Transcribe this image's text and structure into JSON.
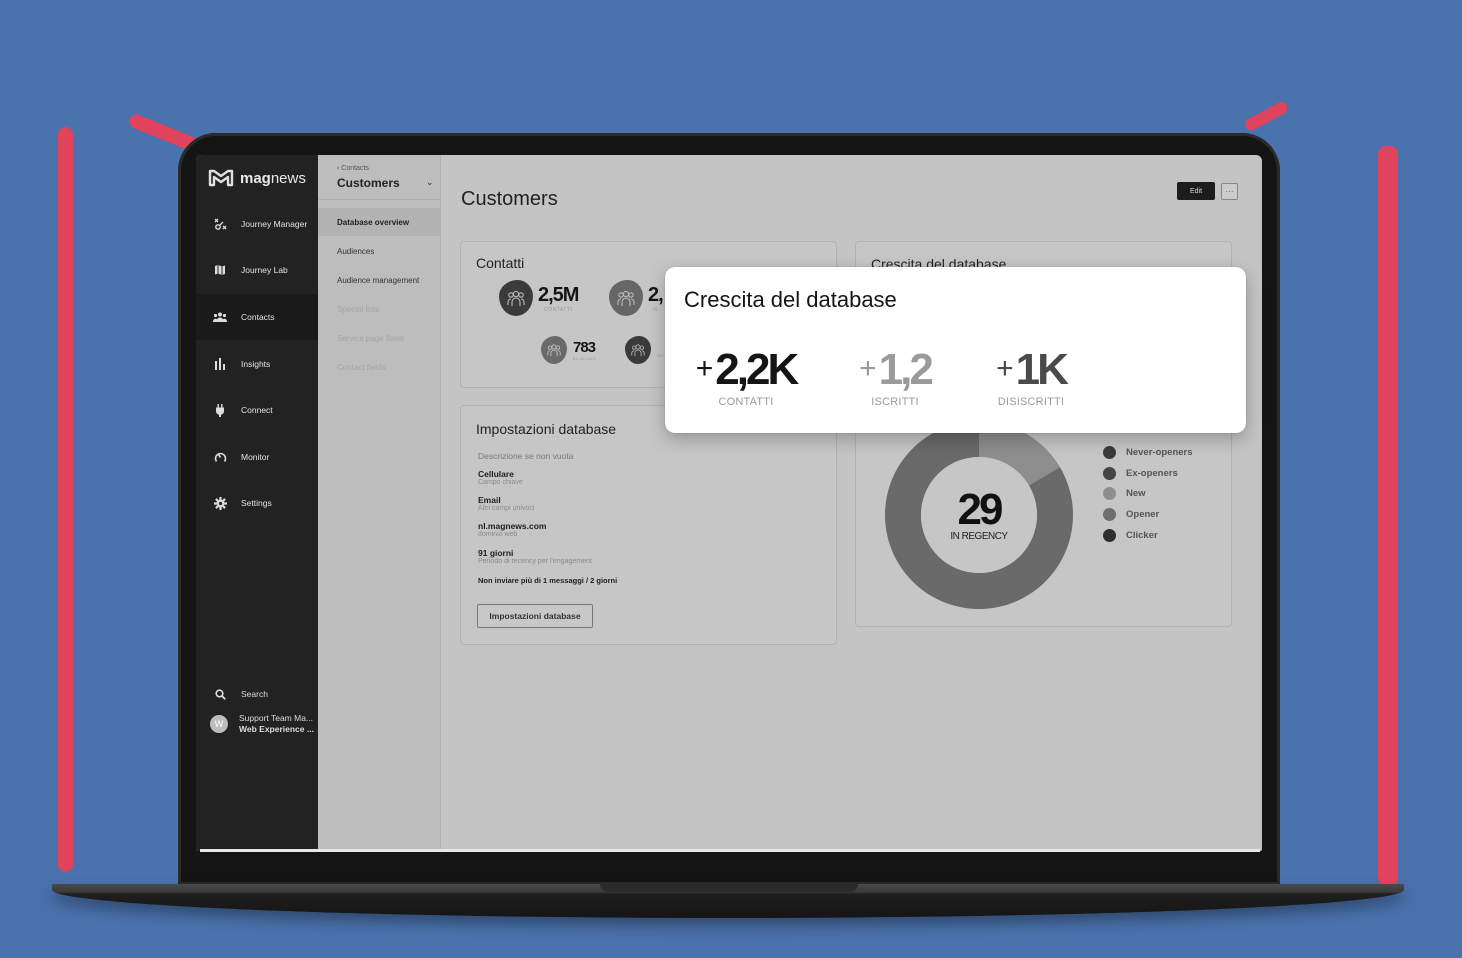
{
  "app": {
    "brand_bold": "mag",
    "brand_light": "news"
  },
  "sidebar": {
    "items": [
      {
        "label": "Journey Manager",
        "icon": "journey-manager-icon"
      },
      {
        "label": "Journey Lab",
        "icon": "map-icon"
      },
      {
        "label": "Contacts",
        "icon": "users-icon",
        "active": true
      },
      {
        "label": "Insights",
        "icon": "bar-chart-icon"
      },
      {
        "label": "Connect",
        "icon": "plug-icon"
      },
      {
        "label": "Monitor",
        "icon": "gauge-icon"
      },
      {
        "label": "Settings",
        "icon": "gear-icon"
      }
    ],
    "search_label": "Search",
    "user": {
      "initial": "W",
      "line1": "Support Team Ma...",
      "line2": "Web Experience ..."
    }
  },
  "subnav": {
    "breadcrumb": "‹ Contacts",
    "title": "Customers",
    "items": [
      {
        "label": "Database overview",
        "state": "active"
      },
      {
        "label": "Audiences",
        "state": "normal"
      },
      {
        "label": "Audience management",
        "state": "normal"
      },
      {
        "label": "Special lists",
        "state": "disabled"
      },
      {
        "label": "Service page flows",
        "state": "disabled"
      },
      {
        "label": "Contact fields",
        "state": "disabled"
      }
    ]
  },
  "main": {
    "title": "Customers",
    "edit_label": "Edit",
    "more_label": "···",
    "contatti_card": {
      "title": "Contatti",
      "stats": [
        {
          "value": "2,5M",
          "label": "CONTATTI"
        },
        {
          "value": "2,",
          "label": "IS"
        },
        {
          "value": "783",
          "label": "ELIMINATI"
        },
        {
          "value": "",
          "label": "NO"
        }
      ]
    },
    "settings_card": {
      "title": "Impostazioni database",
      "description": "Descrizione se non vuota",
      "rows": [
        {
          "main": "Cellulare",
          "sub": "Campo chiave"
        },
        {
          "main": "Email",
          "sub": "Altri campi univoci"
        },
        {
          "main": "nl.magnews.com",
          "sub": "dominio web"
        },
        {
          "main": "91 giorni",
          "sub": "Periodo di recency per l'engagement"
        }
      ],
      "limit_text": "Non inviare più di 1 messaggi / 2 giorni",
      "button_label": "Impostazioni database"
    },
    "growth_card": {
      "title": "Crescita del database"
    }
  },
  "popup": {
    "title": "Crescita del database",
    "stats": [
      {
        "plus": "+",
        "value": "2,2K",
        "label": "CONTATTI",
        "color": "#151515"
      },
      {
        "plus": "+",
        "value": "1,2",
        "label": "ISCRITTI",
        "color": "#9a9a9a"
      },
      {
        "plus": "+",
        "value": "1K",
        "label": "DISISCRITTI",
        "color": "#4a4a4a"
      }
    ]
  },
  "chart_data": {
    "type": "pie",
    "title": "",
    "center_value": "29",
    "center_label": "IN REGENCY",
    "legend_position": "right",
    "legend": [
      {
        "name": "Never-openers",
        "color": "#3a3a3a"
      },
      {
        "name": "Ex-openers",
        "color": "#444444"
      },
      {
        "name": "New",
        "color": "#8e8e8e"
      },
      {
        "name": "Opener",
        "color": "#6e6e6e"
      },
      {
        "name": "Clicker",
        "color": "#2f2f2f"
      }
    ],
    "segments": [
      {
        "name": "New",
        "percent": 16.5,
        "color": "#8e8e8e"
      },
      {
        "name": "Opener",
        "percent": 83.5,
        "color": "#6a6a6a"
      }
    ]
  }
}
